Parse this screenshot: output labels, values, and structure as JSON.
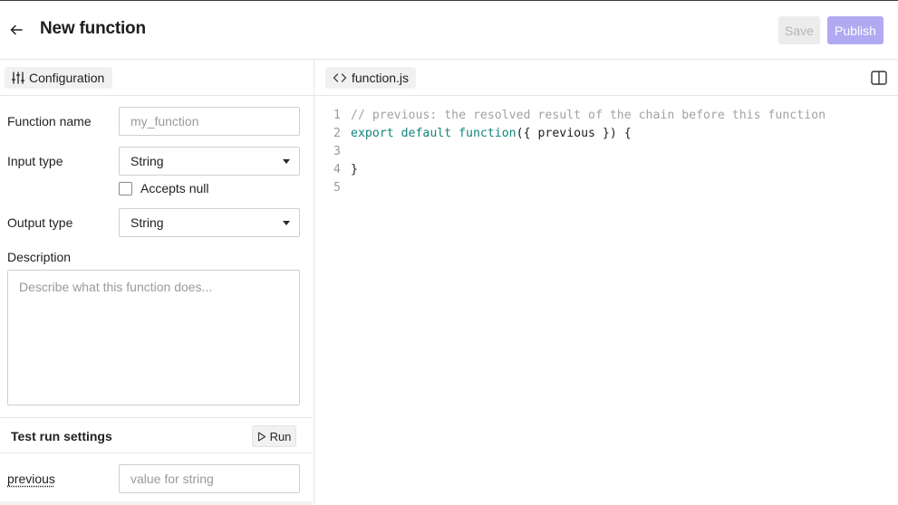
{
  "header": {
    "title": "New function",
    "save_label": "Save",
    "publish_label": "Publish"
  },
  "left_panel": {
    "tab_label": "Configuration",
    "function_name": {
      "label": "Function name",
      "value": "",
      "placeholder": "my_function"
    },
    "input_type": {
      "label": "Input type",
      "value": "String"
    },
    "accepts_null": {
      "label": "Accepts null",
      "checked": false
    },
    "output_type": {
      "label": "Output type",
      "value": "String"
    },
    "description": {
      "label": "Description",
      "placeholder": "Describe what this function does..."
    },
    "test_run": {
      "title": "Test run settings",
      "run_label": "Run",
      "param_label": "previous",
      "param_placeholder": "value for string"
    }
  },
  "editor": {
    "file_tab_label": "function.js",
    "lines": [
      {
        "num": "1",
        "tokens": [
          {
            "t": "// previous: the resolved result of the chain before this function",
            "k": "comment"
          }
        ]
      },
      {
        "num": "2",
        "tokens": [
          {
            "t": "export default",
            "k": "kw"
          },
          {
            "t": " ",
            "k": "plain"
          },
          {
            "t": "function",
            "k": "fn"
          },
          {
            "t": "({ previous }) {",
            "k": "plain"
          }
        ]
      },
      {
        "num": "3",
        "tokens": [
          {
            "t": "",
            "k": "plain"
          }
        ]
      },
      {
        "num": "4",
        "tokens": [
          {
            "t": "}",
            "k": "plain"
          }
        ]
      },
      {
        "num": "5",
        "tokens": [
          {
            "t": "",
            "k": "plain"
          }
        ]
      }
    ]
  },
  "icons": {
    "back": "arrow-left-icon",
    "configuration": "sliders-icon",
    "file": "code-brackets-icon",
    "split": "split-view-icon",
    "run": "play-icon",
    "select": "caret-down-icon"
  },
  "colors": {
    "publish_bg": "#b1aaf2",
    "save_bg": "#ececec",
    "keyword": "#14857a",
    "comment": "#a3a3a3"
  }
}
